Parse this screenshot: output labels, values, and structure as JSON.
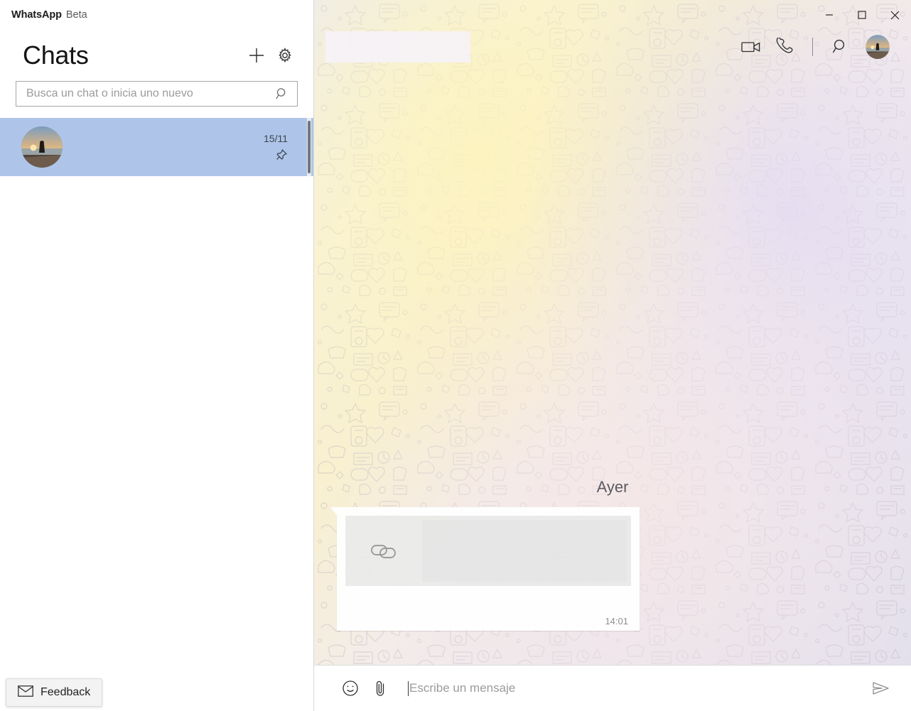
{
  "window": {
    "app_title": "WhatsApp",
    "app_badge": "Beta",
    "controls": {
      "minimize": "minimize-icon",
      "maximize": "maximize-icon",
      "close": "close-icon"
    }
  },
  "sidebar": {
    "heading": "Chats",
    "new_chat_icon": "plus-icon",
    "settings_icon": "gear-icon",
    "search": {
      "placeholder": "Busca un chat o inicia uno nuevo",
      "value": "",
      "icon": "search-icon"
    },
    "chats": [
      {
        "name": "",
        "preview": "",
        "date": "15/11",
        "pinned": true,
        "pin_icon": "pin-icon",
        "selected": true,
        "avatar": "sunset-beach-photo"
      }
    ],
    "feedback": {
      "label": "Feedback",
      "icon": "envelope-icon"
    }
  },
  "chat": {
    "contact_name": "",
    "actions": {
      "video_call_icon": "video-call-icon",
      "voice_call_icon": "phone-icon",
      "search_icon": "search-icon",
      "profile_avatar": "sunset-beach-photo"
    },
    "date_separator": "Ayer",
    "messages": [
      {
        "type": "link-preview",
        "direction": "incoming",
        "link_icon": "link-chain-icon",
        "preview_title": "",
        "preview_description": "",
        "body_text": "",
        "time": "14:01"
      }
    ],
    "composer": {
      "emoji_icon": "emoji-smiley-icon",
      "attach_icon": "paperclip-icon",
      "placeholder": "Escribe un mensaje",
      "value": "",
      "send_icon": "send-arrow-icon"
    }
  },
  "colors": {
    "selected_chat": "#aec5e9",
    "sidebar_bg": "#ffffff",
    "bubble_bg": "#ffffff",
    "chat_bg_start": "#f7f2dd",
    "chat_bg_end": "#e3e0ee"
  }
}
